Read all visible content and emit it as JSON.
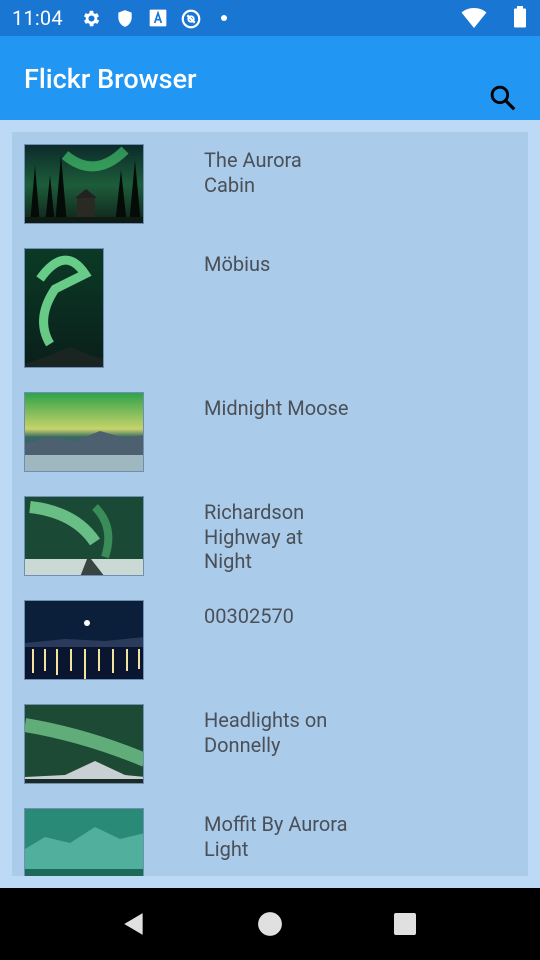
{
  "status_bar": {
    "time": "11:04",
    "icons": [
      "gear-icon",
      "shield-icon",
      "text-a-icon",
      "at-sign-icon",
      "dot-icon",
      "wifi-icon",
      "battery-icon"
    ]
  },
  "app_bar": {
    "title": "Flickr Browser",
    "search_icon": "search-icon"
  },
  "photos": [
    {
      "title": "The Aurora\nCabin"
    },
    {
      "title": "Möbius"
    },
    {
      "title": "Midnight Moose"
    },
    {
      "title": "Richardson\nHighway at\nNight"
    },
    {
      "title": "00302570"
    },
    {
      "title": "Headlights on\nDonnelly"
    },
    {
      "title": "Moffit By Aurora\nLight"
    }
  ],
  "nav_bar": {
    "buttons": [
      "back-icon",
      "home-icon",
      "recents-icon"
    ]
  },
  "colors": {
    "status_bar": "#1976d2",
    "app_bar": "#2196f3",
    "list_background": "#abcbea",
    "page_background": "#bcdaf5",
    "caption_text": "#4a5057"
  }
}
